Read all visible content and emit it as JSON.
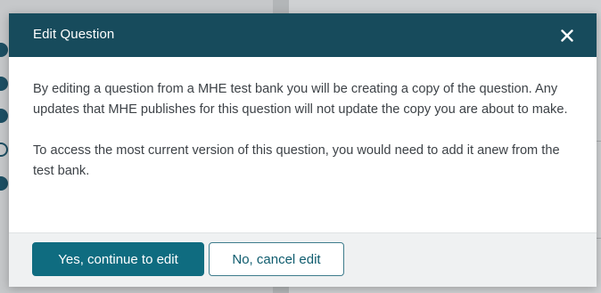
{
  "dialog": {
    "title": "Edit Question",
    "close_icon": "close-icon",
    "body": {
      "paragraph_1": "By editing a question from a MHE test bank you will be creating a copy of the question. Any updates that MHE publishes for this question will not update the copy you are about to make.",
      "paragraph_2": "To access the most current version of this question, you would need to add it anew from the test bank."
    },
    "buttons": {
      "confirm_label": "Yes, continue to edit",
      "cancel_label": "No, cancel edit"
    }
  },
  "colors": {
    "header_bg": "#174b5c",
    "primary_button": "#0f6c80",
    "body_text": "#3d4247",
    "footer_bg": "#eff1f2",
    "overlay_bg": "#c6c8ca"
  }
}
